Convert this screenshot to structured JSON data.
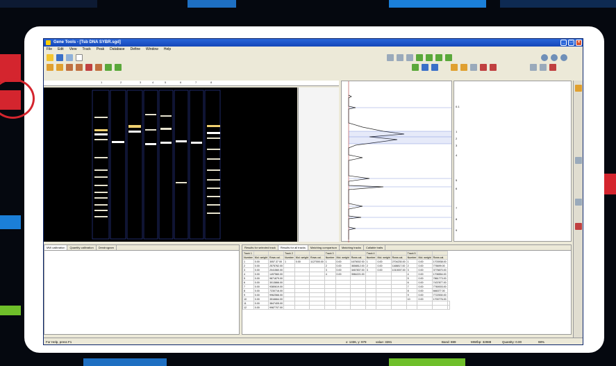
{
  "window": {
    "title": "Gene Tools - [Tsb DNA SYBR.sgd]",
    "menu": [
      "File",
      "Edit",
      "View",
      "Track",
      "Peak",
      "Database",
      "Define",
      "Window",
      "Help"
    ]
  },
  "lanes": {
    "labels": [
      "1",
      "2",
      "3",
      "4",
      "5",
      "6",
      "7",
      "8"
    ]
  },
  "calibration": {
    "labels": [
      "0.1",
      "1",
      "2",
      "3",
      "4",
      "5",
      "6",
      "7",
      "8",
      "9"
    ]
  },
  "bottom_left_tabs": [
    "MW calibration",
    "Quantity calibration",
    "Dendrogram"
  ],
  "bottom_right_tabs": [
    "Results for selected track",
    "Results for all tracks",
    "Matching comparison",
    "Matching tracks",
    "Callable traits"
  ],
  "results": {
    "headers": [
      "Track 1",
      "",
      "",
      "Track 2",
      "",
      "",
      "Track 3",
      "",
      "",
      "Track 4",
      "",
      "",
      "Track 5",
      "",
      ""
    ],
    "subheaders": [
      "Number",
      "Mol. weight",
      "Rows cal.",
      "Number",
      "Mol. weight",
      "Rows cal.",
      "Number",
      "Mol. weight",
      "Rows cal.",
      "Number",
      "Mol. weight",
      "Rows cal.",
      "Number",
      "Mol. weight",
      "Rows cal."
    ],
    "rows": [
      [
        "1",
        "0.00",
        "3057.37 00",
        "1",
        "0.00",
        "1127000.00",
        "1",
        "0.00",
        "1675002 00",
        "1",
        "0.00",
        "2704230.00",
        "1",
        "0.00",
        "1703938.00"
      ],
      [
        "2",
        "0.00",
        "2575762.00",
        "",
        "",
        "",
        "2",
        "0.00",
        "3658812.00",
        "2",
        "0.00",
        "1168817.00",
        "2",
        "0.00",
        "776699.00"
      ],
      [
        "3",
        "0.00",
        "2041560.00",
        "",
        "",
        "",
        "3",
        "0.00",
        "3467837.00",
        "3",
        "0.00",
        "1010007.00",
        "3",
        "0.00",
        "3776670.00"
      ],
      [
        "4",
        "0.00",
        "1497560.00",
        "",
        "",
        "",
        "4",
        "0.00",
        "3984221.00",
        "",
        "",
        "",
        "4",
        "0.00",
        "1706554.00"
      ],
      [
        "5",
        "0.00",
        "9871879.00",
        "",
        "",
        "",
        "",
        "",
        "",
        "",
        "",
        "",
        "5",
        "0.00",
        "7861773.00"
      ],
      [
        "6",
        "0.00",
        "3013866.00",
        "",
        "",
        "",
        "",
        "",
        "",
        "",
        "",
        "",
        "6",
        "0.00",
        "7437877.00"
      ],
      [
        "7",
        "0.00",
        "9380619.00",
        "",
        "",
        "",
        "",
        "",
        "",
        "",
        "",
        "",
        "7",
        "0.00",
        "7760003.00"
      ],
      [
        "8",
        "0.00",
        "7230716.00",
        "",
        "",
        "",
        "",
        "",
        "",
        "",
        "",
        "",
        "8",
        "0.00",
        "666377.00"
      ],
      [
        "9",
        "0.00",
        "9962566.00",
        "",
        "",
        "",
        "",
        "",
        "",
        "",
        "",
        "",
        "9",
        "0.00",
        "7722530.00"
      ],
      [
        "10",
        "0.00",
        "3516664.00",
        "",
        "",
        "",
        "",
        "",
        "",
        "",
        "",
        "",
        "10",
        "0.00",
        "1700776.00"
      ],
      [
        "11",
        "0.00",
        "3847405.00",
        "",
        "",
        "",
        "",
        "",
        "",
        "",
        "",
        "",
        "",
        "",
        "",
        ""
      ],
      [
        "12",
        "0.00",
        "9987707.00",
        "",
        "",
        "",
        "",
        "",
        "",
        "",
        "",
        "",
        "",
        "",
        "",
        ""
      ]
    ]
  },
  "status": {
    "left": "For Help, press F1",
    "coords": "x: 1336, y: 979",
    "value": "value: 3281",
    "band": "Band: 889",
    "mw": "MW/bp: 32988",
    "quantity": "Quantity: 0.00",
    "zoom": "98%"
  },
  "colors": {
    "accent": "#1b7fd8",
    "highlight": "#d4252e",
    "title_blue": "#1446b8"
  }
}
